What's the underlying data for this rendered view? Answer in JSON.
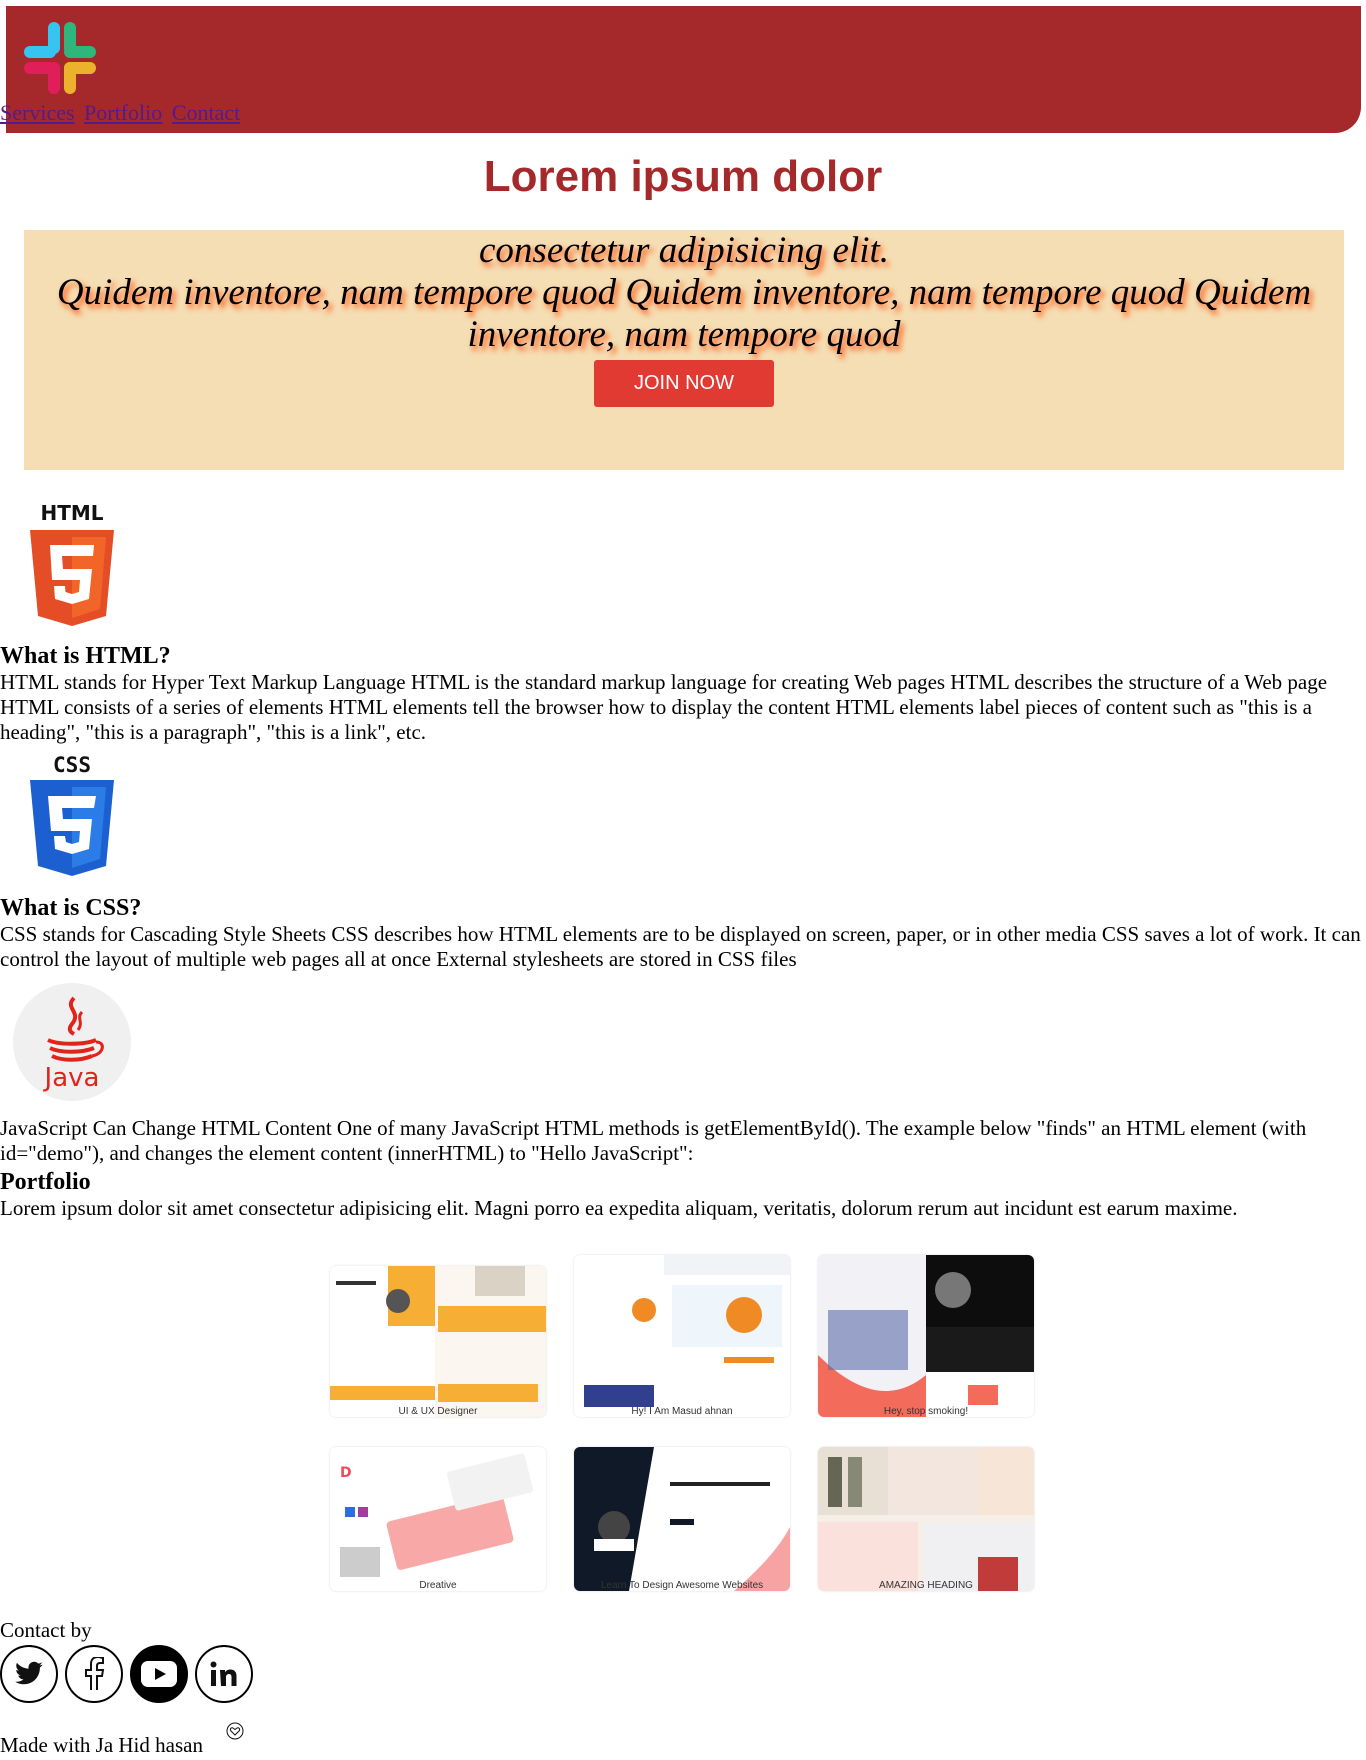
{
  "header": {
    "nav": [
      "Services",
      "Portfolio",
      "Contact"
    ]
  },
  "hero": {
    "title": "Lorem ipsum dolor",
    "line1": "consectetur adipisicing elit.",
    "line2": "Quidem inventore, nam tempore quod Quidem inventore, nam tempore quod Quidem inventore, nam tempore quod",
    "button": "JOIN NOW"
  },
  "html_section": {
    "icon_label": "HTML",
    "heading": "What is HTML?",
    "text": "HTML stands for Hyper Text Markup Language HTML is the standard markup language for creating Web pages HTML describes the structure of a Web page HTML consists of a series of elements HTML elements tell the browser how to display the content HTML elements label pieces of content such as \"this is a heading\", \"this is a paragraph\", \"this is a link\", etc."
  },
  "css_section": {
    "icon_label": "CSS",
    "heading": "What is CSS?",
    "text": "CSS stands for Cascading Style Sheets CSS describes how HTML elements are to be displayed on screen, paper, or in other media CSS saves a lot of work. It can control the layout of multiple web pages all at once External stylesheets are stored in CSS files"
  },
  "js_section": {
    "icon_label": "Java",
    "text": "JavaScript Can Change HTML Content One of many JavaScript HTML methods is getElementById(). The example below \"finds\" an HTML element (with id=\"demo\"), and changes the element content (innerHTML) to \"Hello JavaScript\":"
  },
  "portfolio": {
    "heading": "Portfolio",
    "text": "Lorem ipsum dolor sit amet consectetur adipisicing elit. Magni porro ea expedita aliquam, veritatis, dolorum rerum aut incidunt est earum maxime.",
    "items": [
      {
        "caption": "UI & UX Designer"
      },
      {
        "caption": "Hy! I Am Masud ahnan"
      },
      {
        "caption": "Hey, stop smoking!"
      },
      {
        "caption": "Dreative"
      },
      {
        "caption": "Learn To Design Awesome Websites"
      },
      {
        "caption": "AMAZING HEADING"
      }
    ]
  },
  "footer": {
    "contact_label": "Contact by",
    "socials": [
      "twitter",
      "facebook",
      "youtube",
      "linkedin"
    ],
    "made_with": "Made with Ja Hid hasan"
  },
  "colors": {
    "header": "#a5292a",
    "banner": "#f5deb3",
    "button": "#e03a32"
  }
}
